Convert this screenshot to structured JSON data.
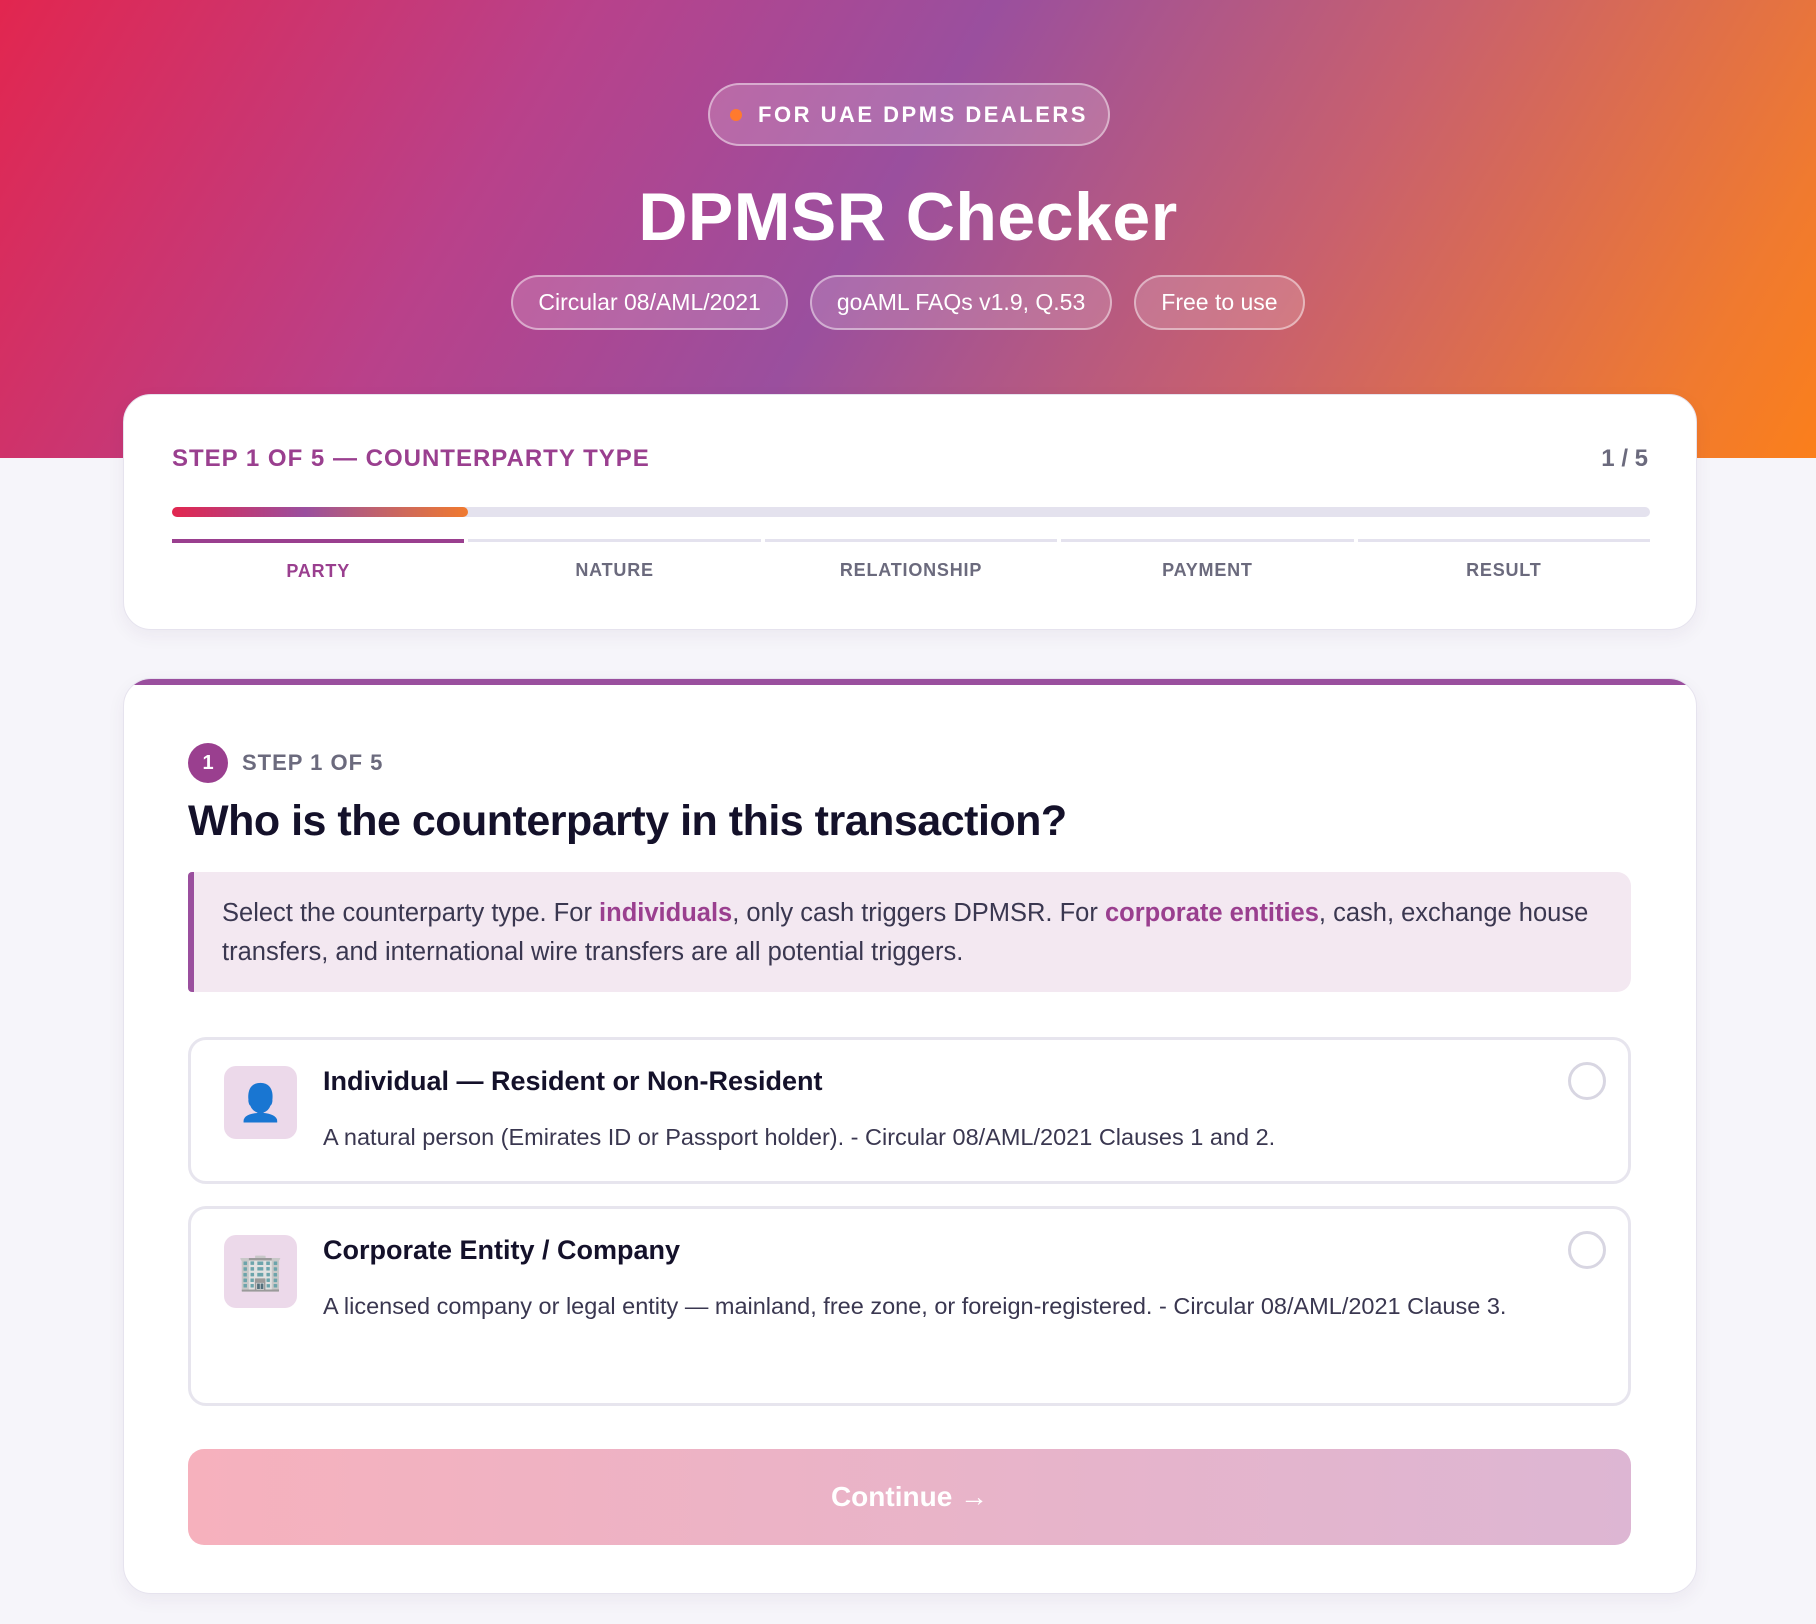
{
  "hero": {
    "badge": "FOR UAE DPMS DEALERS",
    "title": "DPMSR Checker",
    "pills": [
      "Circular 08/AML/2021",
      "goAML FAQs v1.9, Q.53",
      "Free to use"
    ]
  },
  "progress": {
    "label": "STEP 1 OF 5 — COUNTERPARTY TYPE",
    "count": "1 / 5",
    "fraction": 0.2,
    "tabs": [
      "PARTY",
      "NATURE",
      "RELATIONSHIP",
      "PAYMENT",
      "RESULT"
    ],
    "active_tab": 0
  },
  "question": {
    "step_num": "1",
    "step_label": "STEP 1 OF 5",
    "title": "Who is the counterparty in this transaction?",
    "info_parts": [
      "Select the counterparty type. For ",
      "individuals",
      ", only cash triggers DPMSR. For ",
      "corporate entities",
      ", cash, exchange house transfers, and international wire transfers are all potential triggers."
    ],
    "options": [
      {
        "icon": "person-icon",
        "glyph": "👤",
        "title": "Individual — Resident or Non-Resident",
        "desc": "A natural person (Emirates ID or Passport holder). - Circular 08/AML/2021 Clauses 1 and 2."
      },
      {
        "icon": "building-icon",
        "glyph": "🏢",
        "title": "Corporate Entity / Company",
        "desc": "A licensed company or legal entity — mainland, free zone, or foreign-registered. - Circular 08/AML/2021 Clause 3."
      }
    ],
    "continue_label": "Continue →"
  },
  "colors": {
    "accent": "#9a3f8f",
    "gradient_start": "#e2264f",
    "gradient_end": "#fb7f1b"
  }
}
